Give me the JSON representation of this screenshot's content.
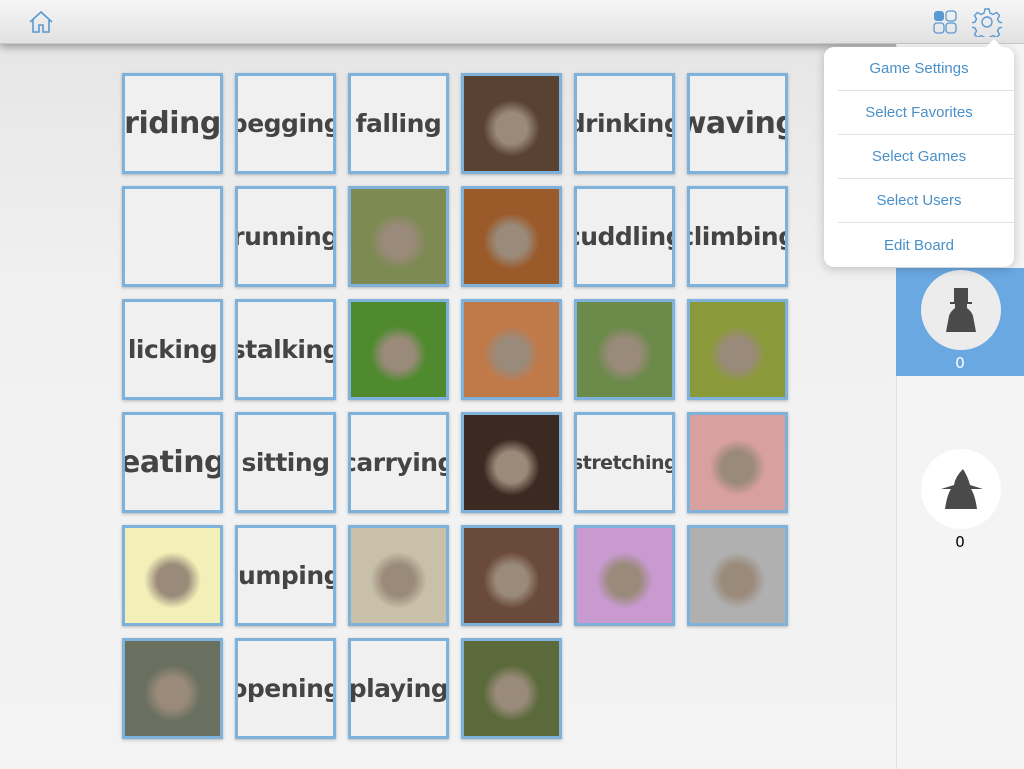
{
  "topbar": {
    "icons": [
      "home-icon",
      "grid-icon",
      "gear-icon"
    ],
    "accent": "#4a90c8"
  },
  "menu": {
    "items": [
      "Game Settings",
      "Select Favorites",
      "Select Games",
      "Select Users",
      "Edit Board"
    ]
  },
  "players": [
    {
      "avatar": "top-hat-player-icon",
      "score": "0",
      "active": true
    },
    {
      "avatar": "witch-hat-player-icon",
      "score": "0",
      "active": false
    }
  ],
  "board": {
    "rows": [
      [
        {
          "t": "riding"
        },
        {
          "t": "begging"
        },
        {
          "t": "falling"
        },
        {
          "p": "cat playing with yarn",
          "c": "#5a4232"
        },
        {
          "t": "drinking"
        },
        {
          "t": "waving"
        }
      ],
      [
        {
          "t": ""
        },
        {
          "t": "running"
        },
        {
          "p": "cat climbing tree",
          "c": "#7d8a52"
        },
        {
          "p": "cat opening door",
          "c": "#9a5a2a"
        },
        {
          "t": "cuddling"
        },
        {
          "t": "climbing"
        }
      ],
      [
        {
          "t": "licking"
        },
        {
          "t": "stalking"
        },
        {
          "p": "white cat running on grass",
          "c": "#4f8a2e"
        },
        {
          "p": "tabby cat sitting",
          "c": "#c07a4a"
        },
        {
          "p": "cat carrying kitten",
          "c": "#6c8a4a"
        },
        {
          "p": "kittens cuddling",
          "c": "#8a9a3a"
        }
      ],
      [
        {
          "t": "eating"
        },
        {
          "t": "sitting"
        },
        {
          "t": "carrying"
        },
        {
          "p": "white cat sitting",
          "c": "#3a2a22"
        },
        {
          "t": "stretching"
        },
        {
          "p": "cat eating from bowl",
          "c": "#d9a0a0"
        }
      ],
      [
        {
          "p": "kitten waving",
          "c": "#f2efb8"
        },
        {
          "t": "jumping"
        },
        {
          "p": "cat jumping in room",
          "c": "#c8c0a8"
        },
        {
          "p": "cat drinking from tap",
          "c": "#6a4a3a"
        },
        {
          "p": "cats riding bicycle",
          "c": "#c89ad0"
        },
        {
          "p": "cat falling",
          "c": "#b0b0b0"
        }
      ],
      [
        {
          "p": "cat stretching",
          "c": "#6a7060"
        },
        {
          "t": "opening"
        },
        {
          "t": "playing"
        },
        {
          "p": "cat stalking in grass",
          "c": "#5a6a3a"
        }
      ]
    ]
  }
}
